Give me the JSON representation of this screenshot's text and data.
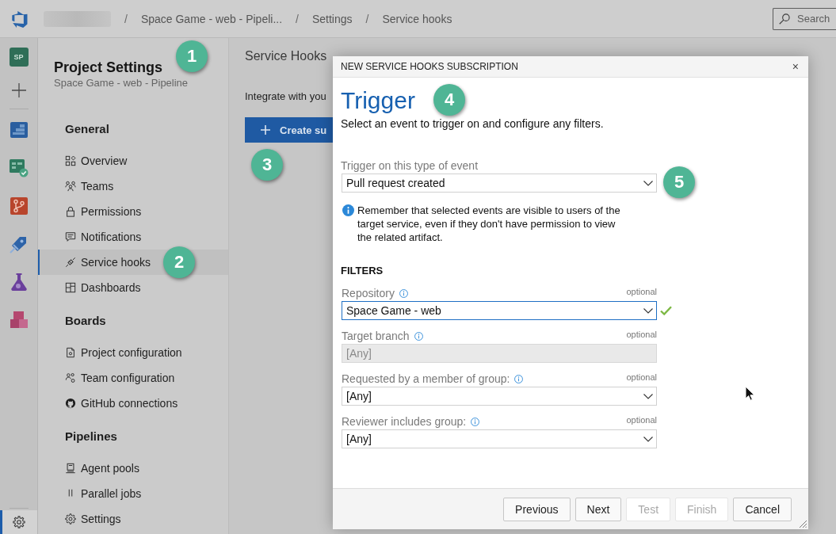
{
  "top_bar": {
    "breadcrumb": [
      {
        "kind": "blurred"
      },
      {
        "kind": "separator",
        "text": "/"
      },
      {
        "kind": "link",
        "text": "Space Game - web - Pipeli..."
      },
      {
        "kind": "separator",
        "text": "/"
      },
      {
        "kind": "link",
        "text": "Settings"
      },
      {
        "kind": "separator",
        "text": "/"
      },
      {
        "kind": "link",
        "text": "Service hooks"
      }
    ],
    "search": {
      "placeholder": "Search"
    }
  },
  "rail": {
    "project_initials": "SP",
    "items": [
      {
        "selected": false
      },
      {
        "selected": false
      },
      {
        "selected": false
      },
      {
        "selected": false
      },
      {
        "selected": false
      },
      {
        "selected": false
      }
    ],
    "settings": {
      "selected": true
    }
  },
  "sidebar": {
    "title": "Project Settings",
    "subtitle": "Space Game - web - Pipeline",
    "sections": [
      {
        "heading": "General",
        "items": [
          {
            "label": "Overview",
            "selected": false
          },
          {
            "label": "Teams",
            "selected": false
          },
          {
            "label": "Permissions",
            "selected": false
          },
          {
            "label": "Notifications",
            "selected": false
          },
          {
            "label": "Service hooks",
            "selected": true
          },
          {
            "label": "Dashboards",
            "selected": false
          }
        ]
      },
      {
        "heading": "Boards",
        "items": [
          {
            "label": "Project configuration",
            "selected": false
          },
          {
            "label": "Team configuration",
            "selected": false
          },
          {
            "label": "GitHub connections",
            "selected": false
          }
        ]
      },
      {
        "heading": "Pipelines",
        "items": [
          {
            "label": "Agent pools",
            "selected": false
          },
          {
            "label": "Parallel jobs",
            "selected": false
          },
          {
            "label": "Settings",
            "selected": false
          }
        ]
      }
    ]
  },
  "main": {
    "title": "Service Hooks",
    "intro": "Integrate with you",
    "create_button": "Create su"
  },
  "dialog": {
    "title": "NEW SERVICE HOOKS SUBSCRIPTION",
    "close": "×",
    "heading": "Trigger",
    "description": "Select an event to trigger on and configure any filters.",
    "event": {
      "label": "Trigger on this type of event",
      "value": "Pull request created"
    },
    "note": "Remember that selected events are visible to users of the target service, even if they don't have permission to view the related artifact.",
    "filters": {
      "heading": "FILTERS",
      "fields": [
        {
          "kind": "dropdown",
          "label": "Repository",
          "tag": "optional",
          "value": "Space Game - web",
          "focused": true,
          "valid": true,
          "disabled": false
        },
        {
          "kind": "text",
          "label": "Target branch",
          "tag": "optional",
          "value": "[Any]",
          "focused": false,
          "valid": false,
          "disabled": true
        },
        {
          "kind": "dropdown",
          "label": "Requested by a member of group:",
          "tag": "optional",
          "value": "[Any]",
          "focused": false,
          "valid": false,
          "disabled": false
        },
        {
          "kind": "dropdown",
          "label": "Reviewer includes group:",
          "tag": "optional",
          "value": "[Any]",
          "focused": false,
          "valid": false,
          "disabled": false
        }
      ]
    },
    "buttons": [
      {
        "label": "Previous",
        "disabled": false
      },
      {
        "label": "Next",
        "disabled": false
      },
      {
        "label": "Test",
        "disabled": true
      },
      {
        "label": "Finish",
        "disabled": true
      },
      {
        "label": "Cancel",
        "disabled": false
      }
    ]
  },
  "callouts": [
    {
      "label": "1"
    },
    {
      "label": "2"
    },
    {
      "label": "3"
    },
    {
      "label": "4"
    },
    {
      "label": "5"
    }
  ]
}
